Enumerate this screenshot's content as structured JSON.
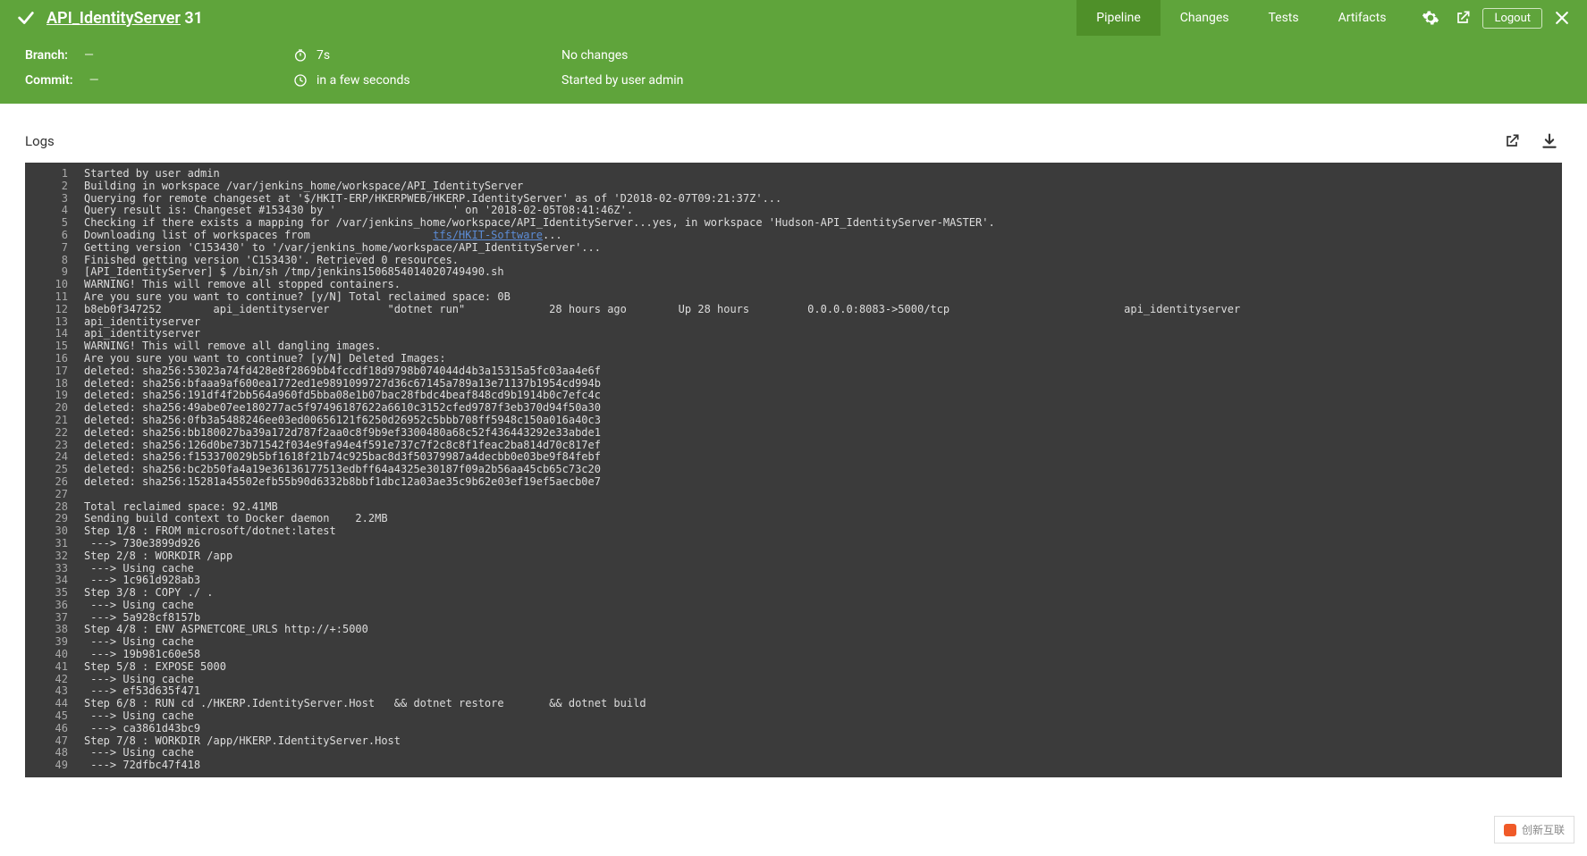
{
  "header": {
    "title_name": "API_IdentityServer",
    "title_num": "31",
    "tabs": {
      "pipeline": "Pipeline",
      "changes": "Changes",
      "tests": "Tests",
      "artifacts": "Artifacts"
    },
    "logout": "Logout"
  },
  "subheader": {
    "branch_label": "Branch:",
    "branch_val": "—",
    "duration": "7s",
    "no_changes": "No changes",
    "commit_label": "Commit:",
    "commit_val": "—",
    "timing": "in a few seconds",
    "started_by": "Started by user admin"
  },
  "logs_title": "Logs",
  "log_lines": [
    {
      "n": 1,
      "t": "Started by user admin"
    },
    {
      "n": 2,
      "t": "Building in workspace /var/jenkins_home/workspace/API_IdentityServer"
    },
    {
      "n": 3,
      "t": "Querying for remote changeset at '$/HKIT-ERP/HKERPWEB/HKERP.IdentityServer' as of 'D2018-02-07T09:21:37Z'..."
    },
    {
      "n": 4,
      "t": "Query result is: Changeset #153430 by '",
      "redacted": true,
      "t2": "' on '2018-02-05T08:41:46Z'."
    },
    {
      "n": 5,
      "t": "Checking if there exists a mapping for /var/jenkins_home/workspace/API_IdentityServer...yes, in workspace 'Hudson-API_IdentityServer-MASTER'."
    },
    {
      "n": 6,
      "t": "Downloading list of workspaces from ",
      "redacted": true,
      "link": "tfs/HKIT-Software",
      "t2": "..."
    },
    {
      "n": 7,
      "t": "Getting version 'C153430' to '/var/jenkins_home/workspace/API_IdentityServer'..."
    },
    {
      "n": 8,
      "t": "Finished getting version 'C153430'. Retrieved 0 resources."
    },
    {
      "n": 9,
      "t": "[API_IdentityServer] $ /bin/sh /tmp/jenkins1506854014020749490.sh"
    },
    {
      "n": 10,
      "t": "WARNING! This will remove all stopped containers."
    },
    {
      "n": 11,
      "t": "Are you sure you want to continue? [y/N] Total reclaimed space: 0B"
    },
    {
      "n": 12,
      "t": "b8eb0f347252        api_identityserver         \"dotnet run\"             28 hours ago        Up 28 hours         0.0.0.0:8083->5000/tcp                           api_identityserver"
    },
    {
      "n": 13,
      "t": "api_identityserver"
    },
    {
      "n": 14,
      "t": "api_identityserver"
    },
    {
      "n": 15,
      "t": "WARNING! This will remove all dangling images."
    },
    {
      "n": 16,
      "t": "Are you sure you want to continue? [y/N] Deleted Images:"
    },
    {
      "n": 17,
      "t": "deleted: sha256:53023a74fd428e8f2869bb4fccdf18d9798b074044d4b3a15315a5fc03aa4e6f"
    },
    {
      "n": 18,
      "t": "deleted: sha256:bfaaa9af600ea1772ed1e9891099727d36c67145a789a13e71137b1954cd994b"
    },
    {
      "n": 19,
      "t": "deleted: sha256:191df4f2bb564a960fd5bba08e1b07bac28fbdc4beaf848cd9b1914b0c7efc4c"
    },
    {
      "n": 20,
      "t": "deleted: sha256:49abe07ee180277ac5f97496187622a6610c3152cfed9787f3eb370d94f50a30"
    },
    {
      "n": 21,
      "t": "deleted: sha256:0fb3a5488246ee03ed00656121f6250d26952c5bbb708ff5948c150a016a40c3"
    },
    {
      "n": 22,
      "t": "deleted: sha256:bb180027ba39a172d787f2aa0c8f9b9ef3300480a68c52f436443292e33abde1"
    },
    {
      "n": 23,
      "t": "deleted: sha256:126d0be73b71542f034e9fa94e4f591e737c7f2c8c8f1feac2ba814d70c817ef"
    },
    {
      "n": 24,
      "t": "deleted: sha256:f153370029b5bf1618f21b74c925bac8d3f50379987a4decbb0e03be9f84febf"
    },
    {
      "n": 25,
      "t": "deleted: sha256:bc2b50fa4a19e36136177513edbff64a4325e30187f09a2b56aa45cb65c73c20"
    },
    {
      "n": 26,
      "t": "deleted: sha256:15281a45502efb55b90d6332b8bbf1dbc12a03ae35c9b62e03ef19ef5aecb0e7"
    },
    {
      "n": 27,
      "t": ""
    },
    {
      "n": 28,
      "t": "Total reclaimed space: 92.41MB"
    },
    {
      "n": 29,
      "t": "Sending build context to Docker daemon    2.2MB"
    },
    {
      "n": 30,
      "t": "Step 1/8 : FROM microsoft/dotnet:latest"
    },
    {
      "n": 31,
      "t": " ---> 730e3899d926"
    },
    {
      "n": 32,
      "t": "Step 2/8 : WORKDIR /app"
    },
    {
      "n": 33,
      "t": " ---> Using cache"
    },
    {
      "n": 34,
      "t": " ---> 1c961d928ab3"
    },
    {
      "n": 35,
      "t": "Step 3/8 : COPY ./ ."
    },
    {
      "n": 36,
      "t": " ---> Using cache"
    },
    {
      "n": 37,
      "t": " ---> 5a928cf8157b"
    },
    {
      "n": 38,
      "t": "Step 4/8 : ENV ASPNETCORE_URLS http://+:5000"
    },
    {
      "n": 39,
      "t": " ---> Using cache"
    },
    {
      "n": 40,
      "t": " ---> 19b981c60e58"
    },
    {
      "n": 41,
      "t": "Step 5/8 : EXPOSE 5000"
    },
    {
      "n": 42,
      "t": " ---> Using cache"
    },
    {
      "n": 43,
      "t": " ---> ef53d635f471"
    },
    {
      "n": 44,
      "t": "Step 6/8 : RUN cd ./HKERP.IdentityServer.Host   && dotnet restore       && dotnet build"
    },
    {
      "n": 45,
      "t": " ---> Using cache"
    },
    {
      "n": 46,
      "t": " ---> ca3861d43bc9"
    },
    {
      "n": 47,
      "t": "Step 7/8 : WORKDIR /app/HKERP.IdentityServer.Host"
    },
    {
      "n": 48,
      "t": " ---> Using cache"
    },
    {
      "n": 49,
      "t": " ---> 72dfbc47f418"
    }
  ],
  "watermark": "创新互联"
}
